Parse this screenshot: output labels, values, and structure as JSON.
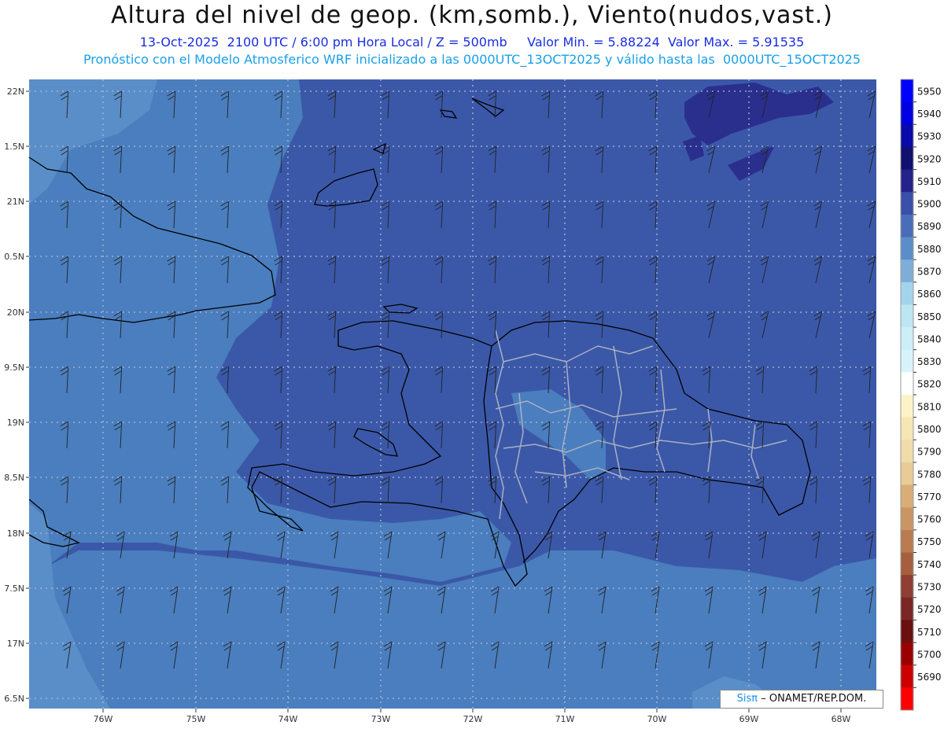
{
  "title": "Altura del nivel de geop. (km,somb.), Viento(nudos,vast.)",
  "subtitle": "13-Oct-2025  2100 UTC / 6:00 pm Hora Local / Z = 500mb     Valor Min. = 5.88224  Valor Max. = 5.91535",
  "subtitle2": "Pronóstico con el Modelo Atmosferico WRF inicializado a las 0000UTC_13OCT2025 y válido hasta las  0000UTC_15OCT2025",
  "lat_labels": [
    "22N",
    "1.5N",
    "21N",
    "0.5N",
    "20N",
    "9.5N",
    "19N",
    "8.5N",
    "18N",
    "7.5N",
    "17N",
    "6.5N"
  ],
  "lon_labels": [
    "76W",
    "75W",
    "74W",
    "73W",
    "72W",
    "71W",
    "70W",
    "69W",
    "68W"
  ],
  "colorbar": {
    "levels": [
      5950,
      5940,
      5930,
      5920,
      5910,
      5900,
      5890,
      5880,
      5870,
      5860,
      5850,
      5840,
      5830,
      5820,
      5810,
      5800,
      5790,
      5780,
      5770,
      5760,
      5750,
      5740,
      5730,
      5720,
      5710,
      5700,
      5690
    ],
    "colors": [
      "#0000ff",
      "#0000e0",
      "#0a0aa8",
      "#10106e",
      "#23238a",
      "#3a4fa8",
      "#4a6db8",
      "#5a8ec8",
      "#7eaed8",
      "#a4d4ec",
      "#bde6f2",
      "#cceef6",
      "#d8f4fa",
      "#ffffff",
      "#fbf3c8",
      "#f5e6b4",
      "#f0dcaa",
      "#e8cb96",
      "#d8ae78",
      "#c99565",
      "#b87c50",
      "#a55f3e",
      "#8c3f32",
      "#7a2626",
      "#6a1010",
      "#9b0000",
      "#cc0000",
      "#ff0000"
    ]
  },
  "credit": {
    "brand": "Sisπ",
    "text": "– ONAMET/REP.DOM."
  },
  "field_colors": {
    "c5880": "#5a8ec8",
    "c5890": "#4a7ebe",
    "c5900": "#3b58a8",
    "c5910": "#2a2f8e"
  }
}
